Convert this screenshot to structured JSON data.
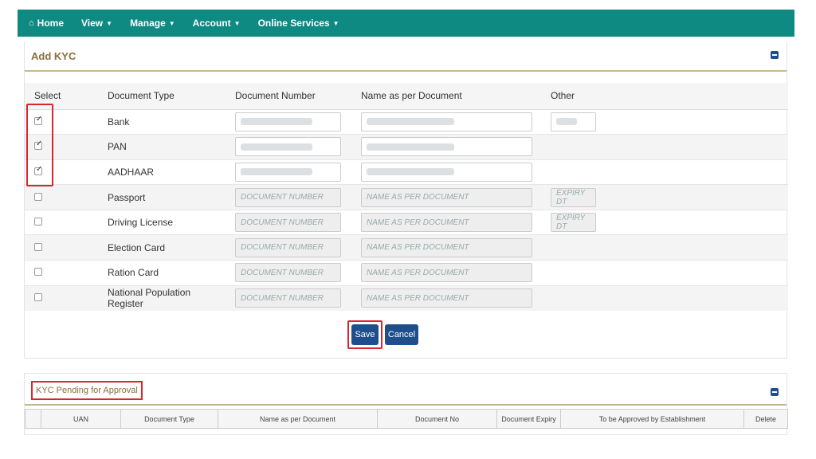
{
  "nav": {
    "home": "Home",
    "view": "View",
    "manage": "Manage",
    "account": "Account",
    "online_services": "Online Services"
  },
  "add_kyc": {
    "title": "Add KYC",
    "columns": [
      "Select",
      "Document Type",
      "Document Number",
      "Name as per Document",
      "Other"
    ],
    "rows": [
      {
        "doc": "Bank",
        "checked": true
      },
      {
        "doc": "PAN",
        "checked": true
      },
      {
        "doc": "AADHAAR",
        "checked": true
      },
      {
        "doc": "Passport",
        "checked": false,
        "num_ph": "DOCUMENT NUMBER",
        "name_ph": "NAME AS PER DOCUMENT",
        "other_ph": "EXPIRY DT"
      },
      {
        "doc": "Driving License",
        "checked": false,
        "num_ph": "DOCUMENT NUMBER",
        "name_ph": "NAME AS PER DOCUMENT",
        "other_ph": "EXPIRY DT"
      },
      {
        "doc": "Election Card",
        "checked": false,
        "num_ph": "DOCUMENT NUMBER",
        "name_ph": "NAME AS PER DOCUMENT"
      },
      {
        "doc": "Ration Card",
        "checked": false,
        "num_ph": "DOCUMENT NUMBER",
        "name_ph": "NAME AS PER DOCUMENT"
      },
      {
        "doc": "National Population Register",
        "checked": false,
        "num_ph": "DOCUMENT NUMBER",
        "name_ph": "NAME AS PER DOCUMENT"
      }
    ],
    "save_label": "Save",
    "cancel_label": "Cancel"
  },
  "pending": {
    "title": "KYC Pending for Approval",
    "columns": [
      "",
      "UAN",
      "Document Type",
      "Name as per Document",
      "Document No",
      "Document Expiry",
      "To be Approved by Establishment",
      "Delete"
    ]
  },
  "colors": {
    "navbar": "#0e8a82",
    "button": "#1f4e8c",
    "highlight": "#d9262c",
    "panel_title": "#8a6d3b"
  }
}
